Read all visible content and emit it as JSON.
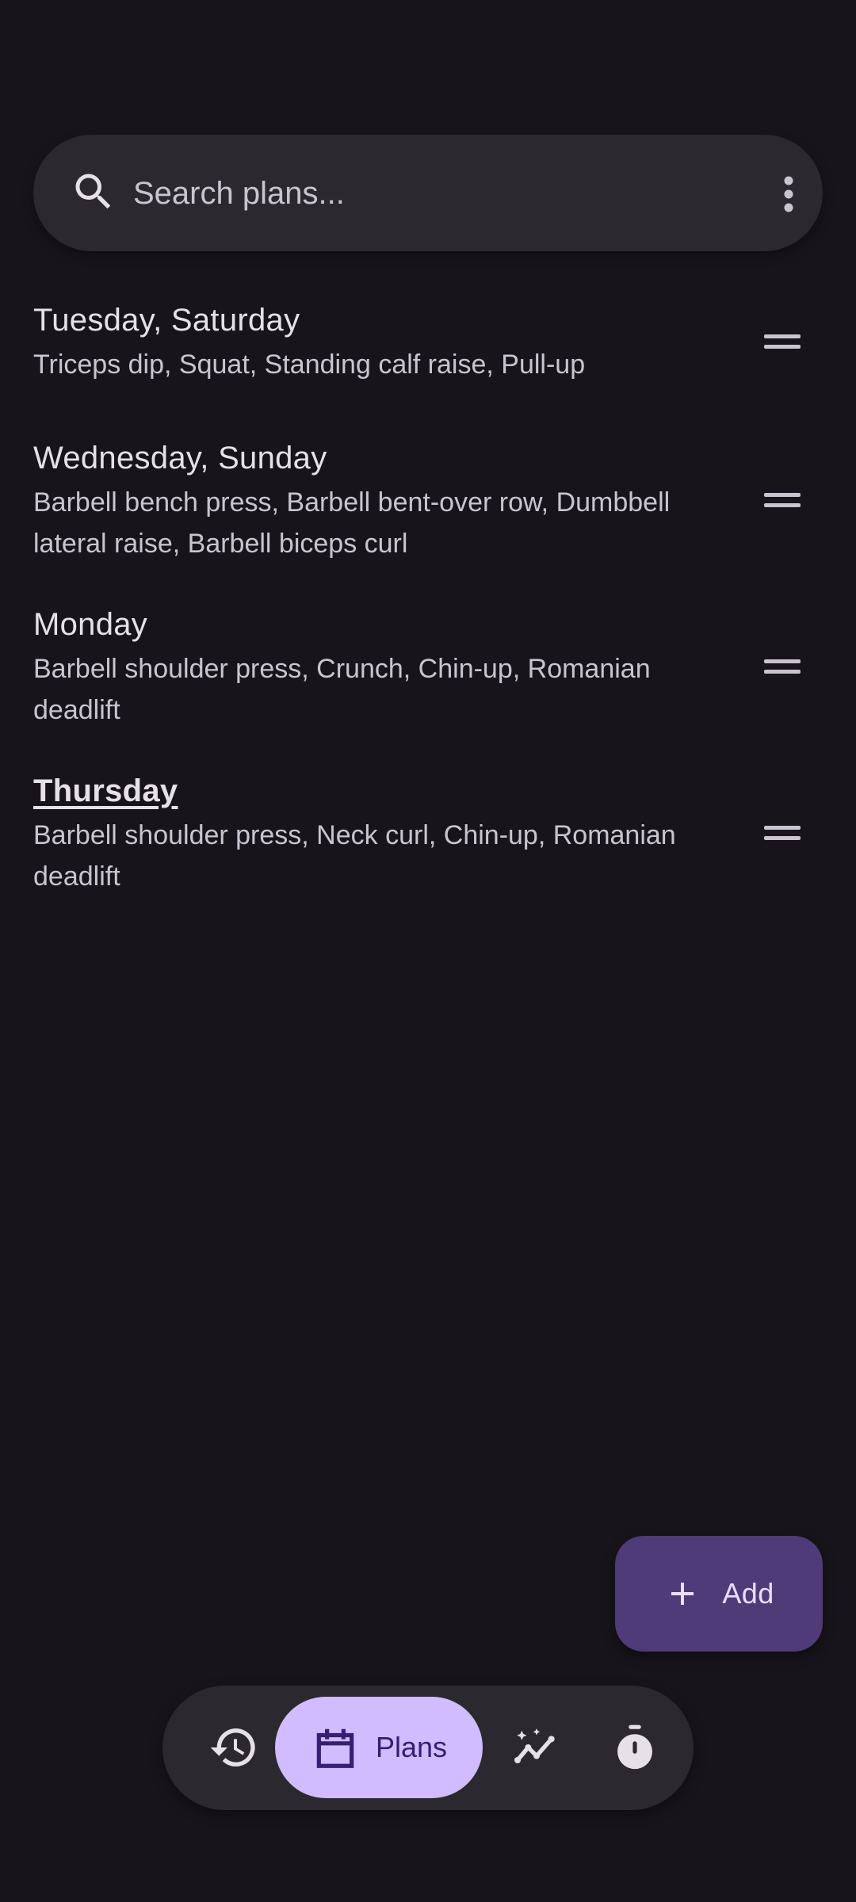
{
  "search": {
    "placeholder": "Search plans..."
  },
  "plans": [
    {
      "title": "Tuesday, Saturday",
      "exercises": "Triceps dip, Squat, Standing calf raise, Pull-up",
      "is_today": false
    },
    {
      "title": "Wednesday, Sunday",
      "exercises": "Barbell bench press, Barbell bent-over row, Dumbbell lateral raise, Barbell biceps curl",
      "is_today": false
    },
    {
      "title": "Monday",
      "exercises": "Barbell shoulder press, Crunch, Chin-up, Romanian deadlift",
      "is_today": false
    },
    {
      "title": "Thursday",
      "exercises": "Barbell shoulder press, Neck curl, Chin-up, Romanian deadlift",
      "is_today": true
    }
  ],
  "fab": {
    "label": "Add",
    "icon": "plus-icon"
  },
  "nav": {
    "items": [
      {
        "icon": "history-icon",
        "label": "",
        "active": false
      },
      {
        "icon": "calendar-icon",
        "label": "Plans",
        "active": true
      },
      {
        "icon": "graph-icon",
        "label": "",
        "active": false
      },
      {
        "icon": "timer-icon",
        "label": "",
        "active": false
      }
    ]
  },
  "colors": {
    "background": "#17151b",
    "surface": "#2b292f",
    "fab": "#4f3b78",
    "nav_active": "#d0bcff",
    "text_primary": "#e6e0e9",
    "text_secondary": "#cac4d0"
  }
}
